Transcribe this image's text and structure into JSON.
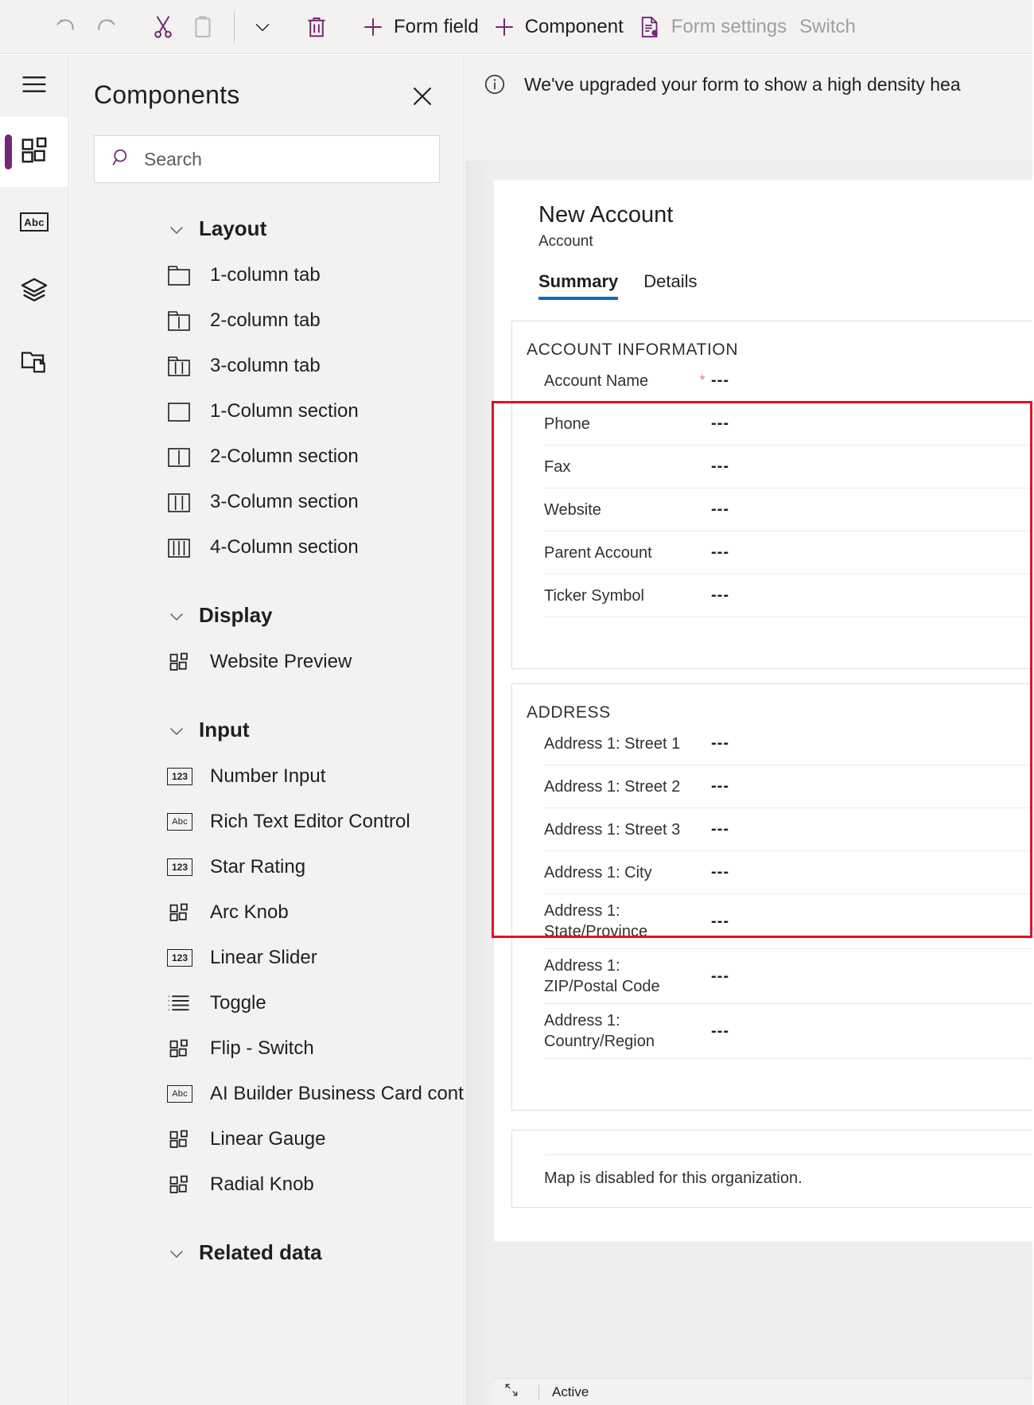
{
  "toolbar": {
    "undo_label": "Undo",
    "redo_label": "Redo",
    "cut_label": "Cut",
    "paste_label": "Paste",
    "more_label": "More",
    "delete_label": "Delete",
    "form_field_label": "Form field",
    "component_label": "Component",
    "form_settings_label": "Form settings",
    "switch_label": "Switch ",
    "accent_color": "#742774",
    "disabled_color": "#a19f9d"
  },
  "rail": {
    "hamburger_label": "Menu",
    "items": [
      {
        "name": "components",
        "icon": "components-icon",
        "active": true
      },
      {
        "name": "text",
        "icon": "abc-badge-icon",
        "badge": "Abc",
        "active": false
      },
      {
        "name": "layers",
        "icon": "layers-icon",
        "active": false
      },
      {
        "name": "copy",
        "icon": "copy-folder-icon",
        "active": false
      }
    ]
  },
  "panel": {
    "title": "Components",
    "close_label": "Close",
    "search": {
      "placeholder": "Search",
      "value": ""
    },
    "groups": [
      {
        "label": "Layout",
        "expanded": true,
        "items": [
          {
            "label": "1-column tab",
            "icon": "tab-1col-icon"
          },
          {
            "label": "2-column tab",
            "icon": "tab-2col-icon"
          },
          {
            "label": "3-column tab",
            "icon": "tab-3col-icon"
          },
          {
            "label": "1-Column section",
            "icon": "section-1col-icon"
          },
          {
            "label": "2-Column section",
            "icon": "section-2col-icon"
          },
          {
            "label": "3-Column section",
            "icon": "section-3col-icon"
          },
          {
            "label": "4-Column section",
            "icon": "section-4col-icon"
          }
        ]
      },
      {
        "label": "Display",
        "expanded": true,
        "items": [
          {
            "label": "Website Preview",
            "icon": "component-tile-icon"
          }
        ]
      },
      {
        "label": "Input",
        "expanded": true,
        "items": [
          {
            "label": "Number Input",
            "icon": "123-badge-icon",
            "badge": "123"
          },
          {
            "label": "Rich Text Editor Control",
            "icon": "abc-badge-icon",
            "badge": "Abc"
          },
          {
            "label": "Star Rating",
            "icon": "123-badge-icon",
            "badge": "123"
          },
          {
            "label": "Arc Knob",
            "icon": "component-tile-icon"
          },
          {
            "label": "Linear Slider",
            "icon": "123-badge-icon",
            "badge": "123"
          },
          {
            "label": "Toggle",
            "icon": "list-icon"
          },
          {
            "label": "Flip - Switch",
            "icon": "component-tile-icon"
          },
          {
            "label": "AI Builder Business Card control",
            "icon": "abc-badge-icon",
            "badge": "Abc"
          },
          {
            "label": "Linear Gauge",
            "icon": "component-tile-icon"
          },
          {
            "label": "Radial Knob",
            "icon": "component-tile-icon"
          }
        ]
      },
      {
        "label": "Related data",
        "expanded": true,
        "items": []
      }
    ]
  },
  "canvas": {
    "notification": {
      "icon": "info-icon",
      "text": "We've upgraded your form to show a high density hea"
    },
    "form": {
      "title": "New Account",
      "subtitle": "Account",
      "tabs": [
        {
          "label": "Summary",
          "active": true
        },
        {
          "label": "Details",
          "active": false
        }
      ],
      "selection_color": "#e81123",
      "sections": [
        {
          "title": "ACCOUNT INFORMATION",
          "fields": [
            {
              "label": "Account Name",
              "required": true,
              "value": "---"
            },
            {
              "label": "Phone",
              "required": false,
              "value": "---"
            },
            {
              "label": "Fax",
              "required": false,
              "value": "---"
            },
            {
              "label": "Website",
              "required": false,
              "value": "---"
            },
            {
              "label": "Parent Account",
              "required": false,
              "value": "---"
            },
            {
              "label": "Ticker Symbol",
              "required": false,
              "value": "---"
            }
          ]
        },
        {
          "title": "ADDRESS",
          "fields": [
            {
              "label": "Address 1: Street 1",
              "required": false,
              "value": "---"
            },
            {
              "label": "Address 1: Street 2",
              "required": false,
              "value": "---"
            },
            {
              "label": "Address 1: Street 3",
              "required": false,
              "value": "---"
            },
            {
              "label": "Address 1: City",
              "required": false,
              "value": "---"
            },
            {
              "label": "Address 1: State/Province",
              "required": false,
              "value": "---"
            },
            {
              "label": "Address 1: ZIP/Postal Code",
              "required": false,
              "value": "---"
            },
            {
              "label": "Address 1: Country/Region",
              "required": false,
              "value": "---"
            }
          ]
        }
      ],
      "map_message": "Map is disabled for this organization.",
      "statusbar": {
        "icon": "expand-icon",
        "status": "Active"
      }
    }
  }
}
